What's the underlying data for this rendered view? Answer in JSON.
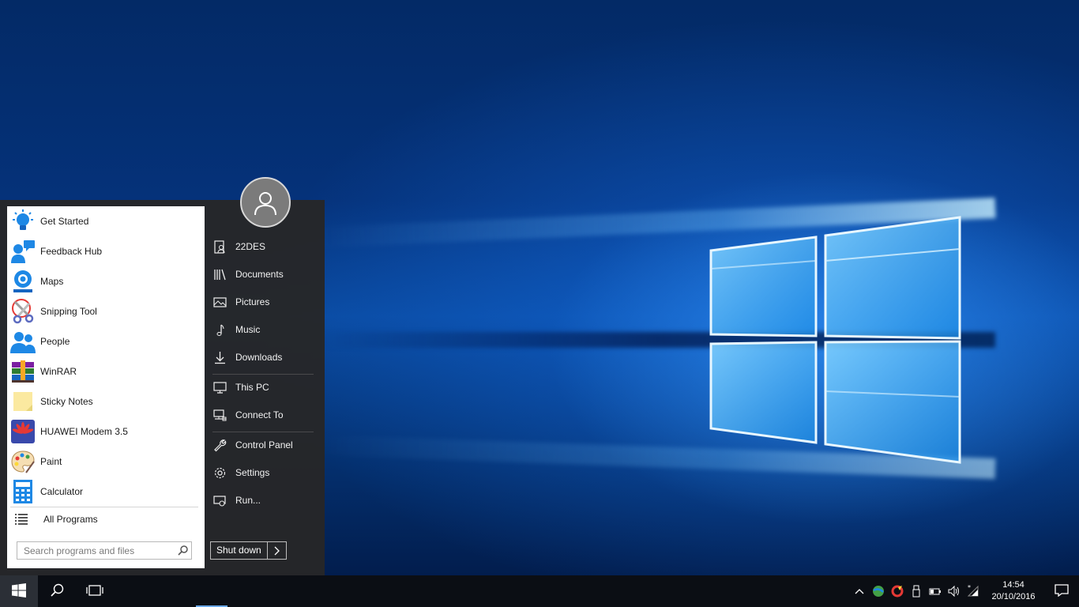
{
  "start_menu": {
    "apps": [
      {
        "label": "Get Started",
        "icon": "lightbulb-icon"
      },
      {
        "label": "Feedback Hub",
        "icon": "feedback-hub-icon"
      },
      {
        "label": "Maps",
        "icon": "maps-icon"
      },
      {
        "label": "Snipping Tool",
        "icon": "scissors-icon"
      },
      {
        "label": "People",
        "icon": "people-icon"
      },
      {
        "label": "WinRAR",
        "icon": "winrar-icon"
      },
      {
        "label": "Sticky Notes",
        "icon": "sticky-note-icon"
      },
      {
        "label": "HUAWEI Modem 3.5",
        "icon": "huawei-icon"
      },
      {
        "label": "Paint",
        "icon": "paint-palette-icon"
      },
      {
        "label": "Calculator",
        "icon": "calculator-icon"
      }
    ],
    "all_programs_label": "All Programs",
    "search_placeholder": "Search programs and files",
    "places": [
      {
        "label": "22DES",
        "icon": "user-folder-icon"
      },
      {
        "label": "Documents",
        "icon": "documents-icon"
      },
      {
        "label": "Pictures",
        "icon": "pictures-icon"
      },
      {
        "label": "Music",
        "icon": "music-note-icon"
      },
      {
        "label": "Downloads",
        "icon": "download-arrow-icon"
      },
      {
        "label": "This PC",
        "icon": "monitor-icon"
      },
      {
        "label": "Connect To",
        "icon": "network-icon"
      },
      {
        "label": "Control Panel",
        "icon": "wrench-icon"
      },
      {
        "label": "Settings",
        "icon": "gear-icon"
      },
      {
        "label": "Run...",
        "icon": "run-icon"
      }
    ],
    "shutdown_label": "Shut down"
  },
  "taskbar": {
    "clock_time": "14:54",
    "clock_date": "20/10/2016",
    "tray_icons": [
      "chevron-up-icon",
      "network-globe-icon",
      "ccleaner-icon",
      "usb-icon",
      "battery-icon",
      "volume-icon",
      "wifi-icon"
    ]
  },
  "colors": {
    "accent": "#1e88e5",
    "taskbar": "#0b0e14",
    "start_menu_dark": "#262628"
  }
}
